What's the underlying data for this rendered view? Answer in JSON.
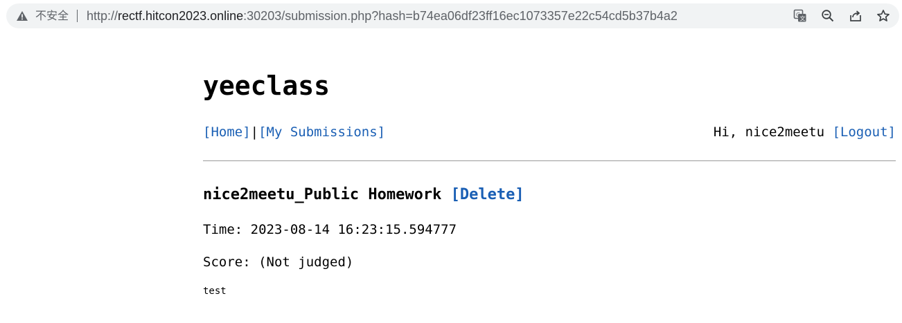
{
  "browser": {
    "insecure_label": "不安全",
    "url_scheme": "http://",
    "url_host": "rectf.hitcon2023.online",
    "url_rest": ":30203/submission.php?hash=b74ea06df23ff16ec1073357e22c54cd5b37b4a2",
    "toolbar_icons": [
      "translate-icon",
      "zoom-icon",
      "share-icon",
      "bookmark-star-icon"
    ]
  },
  "page": {
    "site_title": "yeeclass",
    "nav": {
      "home_label": "[Home]",
      "separator": "|",
      "submissions_label": "[My Submissions]",
      "greeting": "Hi, nice2meetu",
      "logout_label": "[Logout]"
    },
    "submission": {
      "title": "nice2meetu_Public Homework",
      "delete_label": "[Delete]",
      "time_line": "Time: 2023-08-14 16:23:15.594777",
      "score_line": "Score: (Not judged)",
      "body": "test"
    }
  },
  "colors": {
    "link": "#1a5fb4",
    "omnibox_bg": "#f1f3f4",
    "url_muted": "#5f6368",
    "rule": "#9a9a9a"
  }
}
